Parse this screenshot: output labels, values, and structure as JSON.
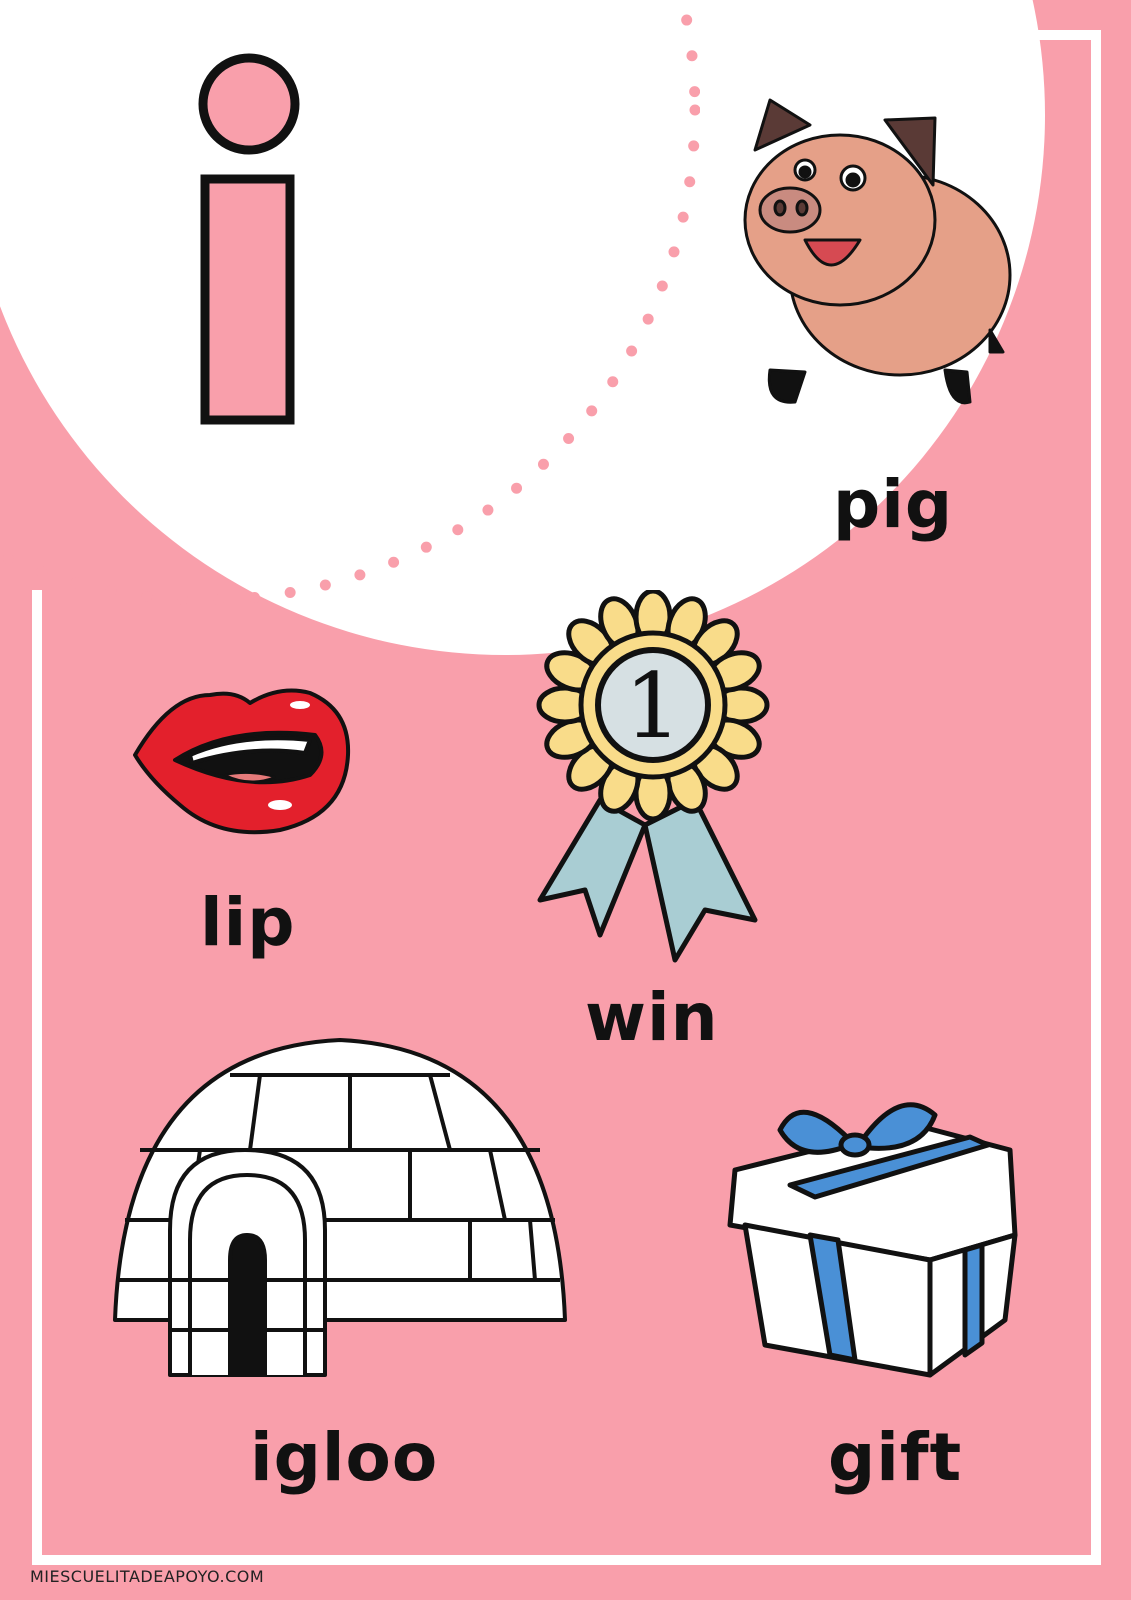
{
  "poster": {
    "letter": "i",
    "colors": {
      "background": "#f99fab",
      "frame": "#ffffff",
      "letter_fill": "#f99fab",
      "outline": "#111111"
    },
    "words": [
      {
        "word": "pig",
        "icon": "pig-icon"
      },
      {
        "word": "lip",
        "icon": "lips-icon"
      },
      {
        "word": "win",
        "icon": "ribbon-icon"
      },
      {
        "word": "igloo",
        "icon": "igloo-icon"
      },
      {
        "word": "gift",
        "icon": "gift-icon"
      }
    ],
    "footer": "MIESCUELITADEAPOYO.COM"
  }
}
